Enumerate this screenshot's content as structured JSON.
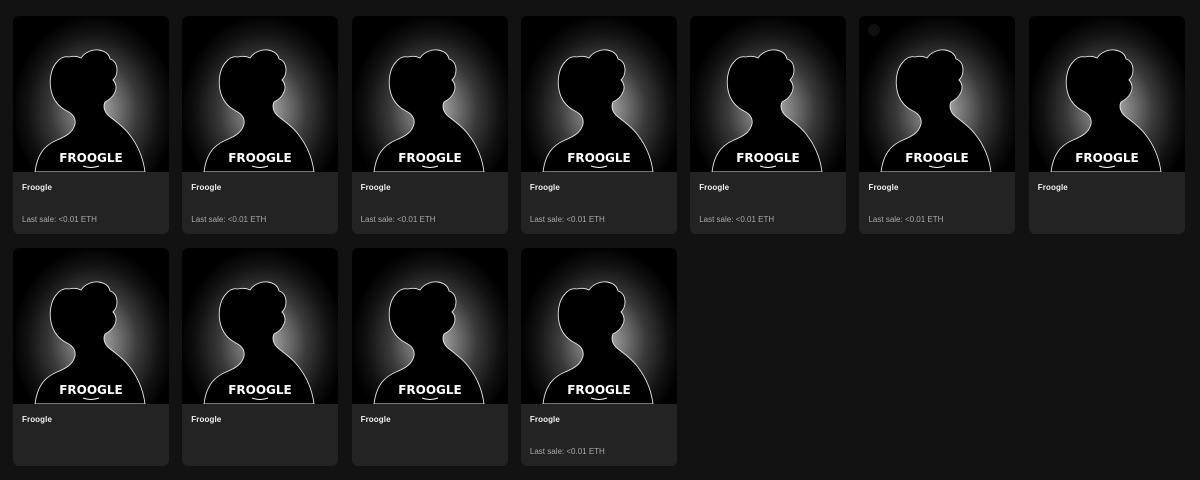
{
  "cards": [
    {
      "name": "Froogle",
      "last_sale": "Last sale: <0.01 ETH"
    },
    {
      "name": "Froogle",
      "last_sale": "Last sale: <0.01 ETH"
    },
    {
      "name": "Froogle",
      "last_sale": "Last sale: <0.01 ETH"
    },
    {
      "name": "Froogle",
      "last_sale": "Last sale: <0.01 ETH"
    },
    {
      "name": "Froogle",
      "last_sale": "Last sale: <0.01 ETH"
    },
    {
      "name": "Froogle",
      "last_sale": "Last sale: <0.01 ETH"
    },
    {
      "name": "Froogle",
      "last_sale": ""
    },
    {
      "name": "Froogle",
      "last_sale": ""
    },
    {
      "name": "Froogle",
      "last_sale": ""
    },
    {
      "name": "Froogle",
      "last_sale": ""
    },
    {
      "name": "Froogle",
      "last_sale": "Last sale: <0.01 ETH"
    }
  ],
  "logo_text": "FROOGLE",
  "colors": {
    "page_background": "#121212",
    "card_background": "#232323",
    "name_text": "#f0f0f0",
    "sale_text": "#a8a8a8"
  }
}
